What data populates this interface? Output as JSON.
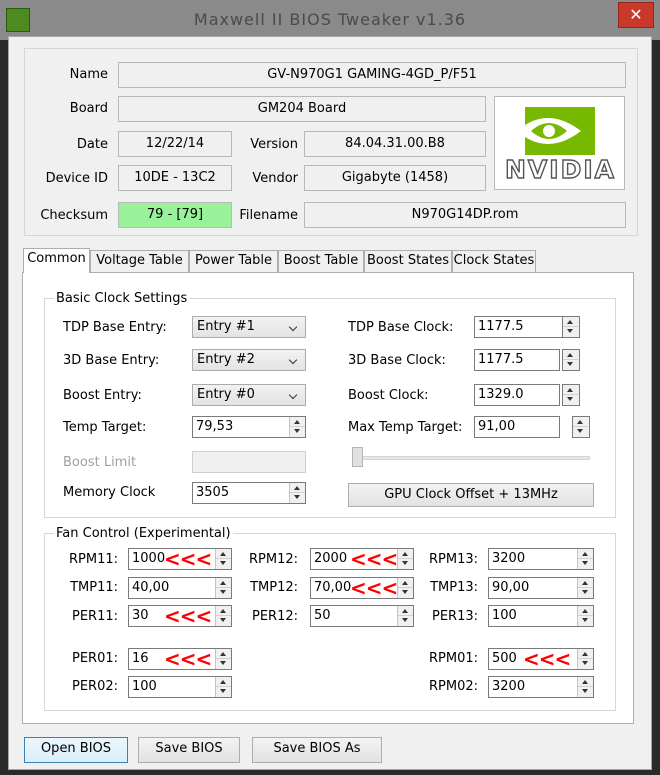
{
  "window": {
    "title": "Maxwell II BIOS Tweaker v1.36",
    "close_glyph": "✕"
  },
  "info": {
    "name_label": "Name",
    "name_value": "GV-N970G1 GAMING-4GD_P/F51",
    "board_label": "Board",
    "board_value": "GM204 Board",
    "date_label": "Date",
    "date_value": "12/22/14",
    "version_label": "Version",
    "version_value": "84.04.31.00.B8",
    "device_id_label": "Device ID",
    "device_id_value": "10DE - 13C2",
    "vendor_label": "Vendor",
    "vendor_value": "Gigabyte (1458)",
    "checksum_label": "Checksum",
    "checksum_value": "79 - [79]",
    "checksum_color": "#98f29a",
    "filename_label": "Filename",
    "filename_value": "N970G14DP.rom",
    "logo_text": "NVIDIA"
  },
  "tabs": [
    {
      "label": "Common",
      "active": true
    },
    {
      "label": "Voltage Table"
    },
    {
      "label": "Power Table"
    },
    {
      "label": "Boost Table"
    },
    {
      "label": "Boost States"
    },
    {
      "label": "Clock States"
    }
  ],
  "basic_clock": {
    "title": "Basic Clock Settings",
    "tdp_base_entry_label": "TDP Base Entry:",
    "tdp_base_entry_value": "Entry #1",
    "base_3d_entry_label": "3D Base Entry:",
    "base_3d_entry_value": "Entry #2",
    "boost_entry_label": "Boost Entry:",
    "boost_entry_value": "Entry #0",
    "temp_target_label": "Temp Target:",
    "temp_target_value": "79,53",
    "boost_limit_label": "Boost Limit",
    "memory_clock_label": "Memory Clock",
    "memory_clock_value": "3505",
    "tdp_base_clock_label": "TDP Base Clock:",
    "tdp_base_clock_value": "1177.5",
    "base_3d_clock_label": "3D Base Clock:",
    "base_3d_clock_value": "1177.5",
    "boost_clock_label": "Boost Clock:",
    "boost_clock_value": "1329.0",
    "max_temp_target_label": "Max Temp Target:",
    "max_temp_target_value": "91,00",
    "slider_value": 0,
    "gpu_offset_button": "GPU Clock Offset + 13MHz"
  },
  "fan": {
    "title": "Fan Control (Experimental)",
    "rpm11_label": "RPM11:",
    "rpm11_value": "1000",
    "tmp11_label": "TMP11:",
    "tmp11_value": "40,00",
    "per11_label": "PER11:",
    "per11_value": "30",
    "rpm12_label": "RPM12:",
    "rpm12_value": "2000",
    "tmp12_label": "TMP12:",
    "tmp12_value": "70,00",
    "per12_label": "PER12:",
    "per12_value": "50",
    "rpm13_label": "RPM13:",
    "rpm13_value": "3200",
    "tmp13_label": "TMP13:",
    "tmp13_value": "90,00",
    "per13_label": "PER13:",
    "per13_value": "100",
    "per01_label": "PER01:",
    "per01_value": "16",
    "per02_label": "PER02:",
    "per02_value": "100",
    "rpm01_label": "RPM01:",
    "rpm01_value": "500",
    "rpm02_label": "RPM02:",
    "rpm02_value": "3200",
    "arrow_marker": "<<<",
    "arrow_color": "#ff0000"
  },
  "buttons": {
    "open": "Open BIOS",
    "save": "Save BIOS",
    "save_as": "Save BIOS As"
  }
}
